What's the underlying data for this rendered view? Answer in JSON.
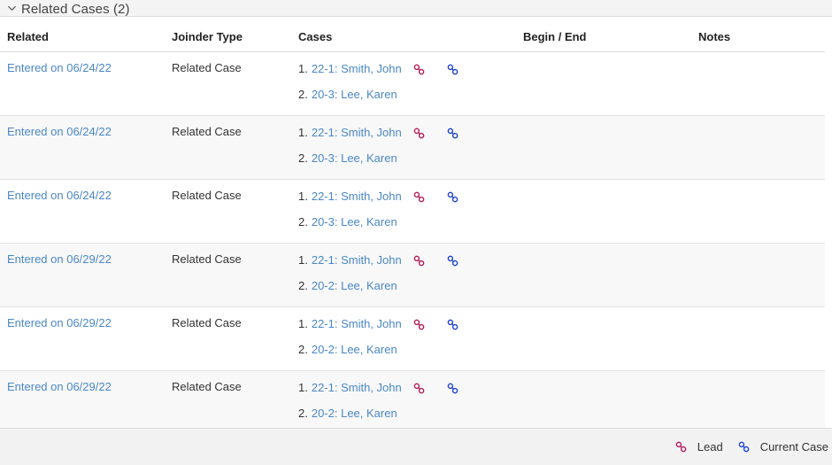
{
  "section": {
    "title": "Related Cases (2)",
    "collapse_icon": "chevron-down-icon",
    "expanded": true
  },
  "table": {
    "columns": [
      {
        "key": "related",
        "label": "Related"
      },
      {
        "key": "joinder",
        "label": "Joinder Type"
      },
      {
        "key": "cases",
        "label": "Cases"
      },
      {
        "key": "begin_end",
        "label": "Begin / End"
      },
      {
        "key": "notes",
        "label": "Notes"
      }
    ],
    "rows": [
      {
        "related": "Entered on 06/24/22",
        "joinder": "Related Case",
        "cases": [
          {
            "num": "1.",
            "label": "22-1: Smith, John",
            "icons": [
              "lead-link-icon",
              "current-case-link-icon"
            ]
          },
          {
            "num": "2.",
            "label": "20-3: Lee, Karen",
            "icons": []
          }
        ],
        "begin_end": "",
        "notes": ""
      },
      {
        "related": "Entered on 06/24/22",
        "joinder": "Related Case",
        "cases": [
          {
            "num": "1.",
            "label": "22-1: Smith, John",
            "icons": [
              "lead-link-icon",
              "current-case-link-icon"
            ]
          },
          {
            "num": "2.",
            "label": "20-3: Lee, Karen",
            "icons": []
          }
        ],
        "begin_end": "",
        "notes": ""
      },
      {
        "related": "Entered on 06/24/22",
        "joinder": "Related Case",
        "cases": [
          {
            "num": "1.",
            "label": "22-1: Smith, John",
            "icons": [
              "lead-link-icon",
              "current-case-link-icon"
            ]
          },
          {
            "num": "2.",
            "label": "20-3: Lee, Karen",
            "icons": []
          }
        ],
        "begin_end": "",
        "notes": ""
      },
      {
        "related": "Entered on 06/29/22",
        "joinder": "Related Case",
        "cases": [
          {
            "num": "1.",
            "label": "22-1: Smith, John",
            "icons": [
              "lead-link-icon",
              "current-case-link-icon"
            ]
          },
          {
            "num": "2.",
            "label": "20-2: Lee, Karen",
            "icons": []
          }
        ],
        "begin_end": "",
        "notes": ""
      },
      {
        "related": "Entered on 06/29/22",
        "joinder": "Related Case",
        "cases": [
          {
            "num": "1.",
            "label": "22-1: Smith, John",
            "icons": [
              "lead-link-icon",
              "current-case-link-icon"
            ]
          },
          {
            "num": "2.",
            "label": "20-2: Lee, Karen",
            "icons": []
          }
        ],
        "begin_end": "",
        "notes": ""
      },
      {
        "related": "Entered on 06/29/22",
        "joinder": "Related Case",
        "cases": [
          {
            "num": "1.",
            "label": "22-1: Smith, John",
            "icons": [
              "lead-link-icon",
              "current-case-link-icon"
            ]
          },
          {
            "num": "2.",
            "label": "20-2: Lee, Karen",
            "icons": []
          }
        ],
        "begin_end": "",
        "notes": ""
      }
    ]
  },
  "legend": [
    {
      "icon": "lead-link-icon",
      "label": "Lead",
      "color": "#b5175a"
    },
    {
      "icon": "current-case-link-icon",
      "label": "Current Case",
      "color": "#1a3fd0"
    }
  ],
  "colors": {
    "link": "#4a87c7",
    "lead_icon": "#b5175a",
    "current_icon": "#1a3fd0",
    "header_bg": "#f4f4f4",
    "row_alt_bg": "#f8f8f8",
    "legend_bg": "#f2f2f2",
    "border": "#dddddd"
  }
}
